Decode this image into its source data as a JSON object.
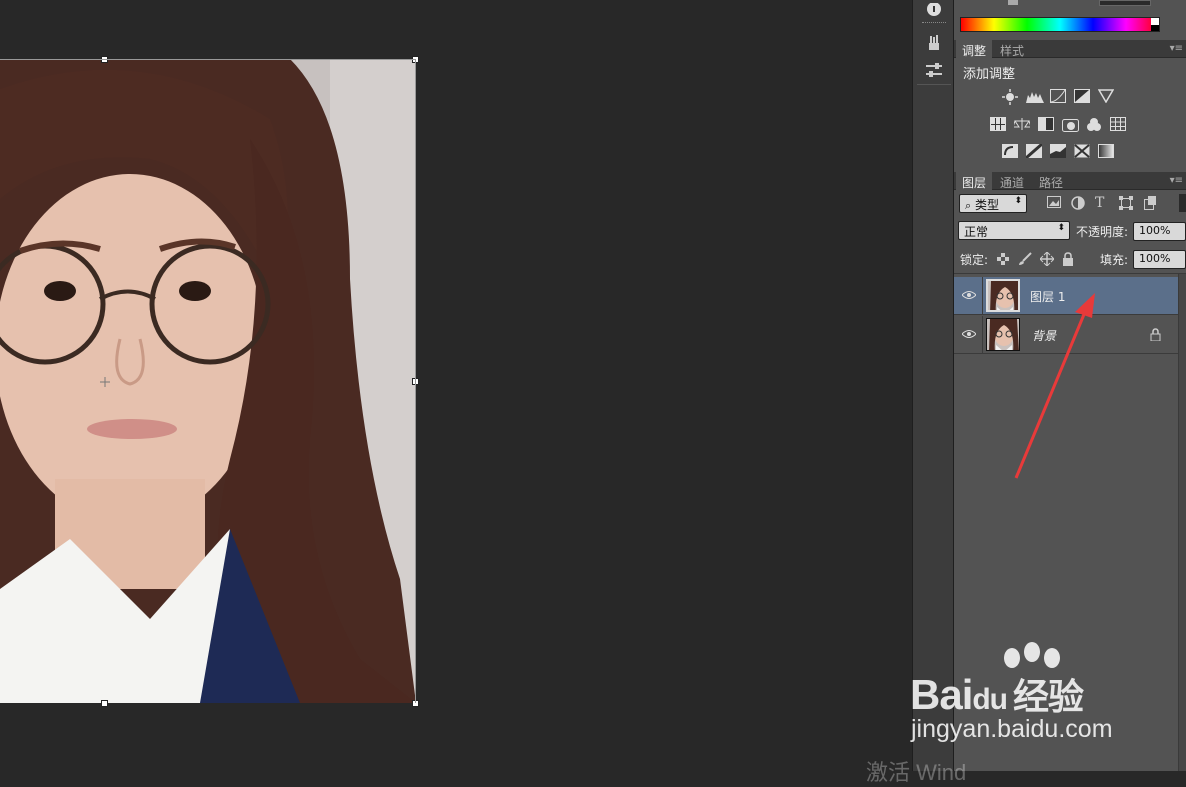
{
  "adjustments_panel": {
    "tabs": [
      "调整",
      "样式"
    ],
    "title": "添加调整"
  },
  "layers_panel": {
    "tabs": [
      "图层",
      "通道",
      "路径"
    ],
    "filter_kind": "类型",
    "blend_mode": "正常",
    "opacity_label": "不透明度:",
    "opacity_value": "100%",
    "lock_label": "锁定:",
    "fill_label": "填充:",
    "fill_value": "100%",
    "layers": [
      {
        "name": "图层 1",
        "selected": true,
        "locked": false
      },
      {
        "name": "背景",
        "selected": false,
        "locked": true
      }
    ]
  },
  "watermark": {
    "brand": "Bai",
    "brand2": "du",
    "brand3": "经验",
    "url": "jingyan.baidu.com",
    "activate_text": "激活 Wind"
  },
  "colors": {
    "selected_layer": "#5b6f8a",
    "arrow": "#e83a3a",
    "panel_bg": "#535353"
  }
}
